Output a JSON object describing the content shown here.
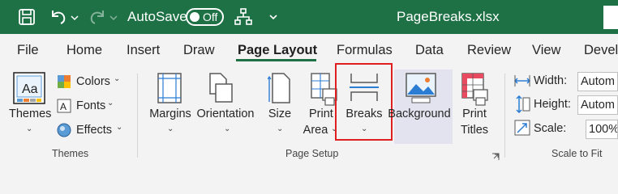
{
  "titlebar": {
    "autosave_label": "AutoSave",
    "autosave_state": "Off",
    "filename": "PageBreaks.xlsx"
  },
  "menu": {
    "tabs": [
      {
        "label": "File"
      },
      {
        "label": "Home"
      },
      {
        "label": "Insert"
      },
      {
        "label": "Draw"
      },
      {
        "label": "Page Layout",
        "active": true
      },
      {
        "label": "Formulas"
      },
      {
        "label": "Data"
      },
      {
        "label": "Review"
      },
      {
        "label": "View"
      },
      {
        "label": "Devel"
      }
    ]
  },
  "ribbon": {
    "themes_group": {
      "label": "Themes",
      "themes_button": "Themes",
      "colors": "Colors",
      "fonts": "Fonts",
      "effects": "Effects"
    },
    "page_setup_group": {
      "label": "Page Setup",
      "margins": "Margins",
      "orientation": "Orientation",
      "size": "Size",
      "print_area_line1": "Print",
      "print_area_line2": "Area",
      "breaks": "Breaks",
      "background": "Background",
      "print_titles_line1": "Print",
      "print_titles_line2": "Titles"
    },
    "scale_group": {
      "label": "Scale to Fit",
      "width_label": "Width:",
      "width_value": "Autom",
      "height_label": "Height:",
      "height_value": "Autom",
      "scale_label": "Scale:",
      "scale_value": "100%"
    }
  },
  "colors": {
    "excel_green": "#1e7145",
    "highlight_red": "#e02020"
  }
}
